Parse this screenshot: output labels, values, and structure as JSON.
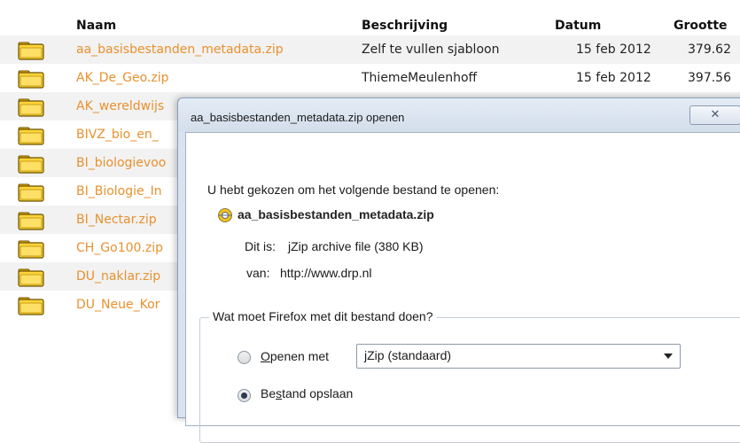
{
  "table": {
    "headers": {
      "name": "Naam",
      "description": "Beschrijving",
      "date": "Datum",
      "size": "Grootte"
    },
    "rows": [
      {
        "name": "aa_basisbestanden_metadata.zip",
        "description": "Zelf te vullen sjabloon",
        "date": "15 feb 2012",
        "size": "379.62"
      },
      {
        "name": "AK_De_Geo.zip",
        "description": "ThiemeMeulenhoff",
        "date": "15 feb 2012",
        "size": "397.56"
      },
      {
        "name": "AK_wereldwijs",
        "description": "",
        "date": "",
        "size": ""
      },
      {
        "name": "BIVZ_bio_en_",
        "description": "",
        "date": "",
        "size": ""
      },
      {
        "name": "BI_biologievoo",
        "description": "",
        "date": "",
        "size": ""
      },
      {
        "name": "BI_Biologie_In",
        "description": "",
        "date": "",
        "size": ""
      },
      {
        "name": "BI_Nectar.zip",
        "description": "",
        "date": "",
        "size": ""
      },
      {
        "name": "CH_Go100.zip",
        "description": "",
        "date": "",
        "size": ""
      },
      {
        "name": "DU_naklar.zip",
        "description": "",
        "date": "",
        "size": ""
      },
      {
        "name": "DU_Neue_Kor",
        "description": "",
        "date": "",
        "size": ""
      }
    ],
    "folder_icon": "zip-folder-icon",
    "link_color": "#e8912e"
  },
  "dialog": {
    "title": "aa_basisbestanden_metadata.zip openen",
    "close_label": "✕",
    "intro": "U hebt gekozen om het volgende bestand te openen:",
    "filename": "aa_basisbestanden_metadata.zip",
    "type_label": "Dit is:",
    "type_value": "jZip archive file (380 KB)",
    "from_label": "van:",
    "from_value": "http://www.drp.nl",
    "group_legend": "Wat moet Firefox met dit bestand doen?",
    "open_with": {
      "accesskey": "O",
      "rest": "penen met",
      "selected": false
    },
    "app_select": "jZip (standaard)",
    "save_file": {
      "pre": "Be",
      "accesskey": "s",
      "rest": "tand opslaan",
      "selected": true
    }
  }
}
